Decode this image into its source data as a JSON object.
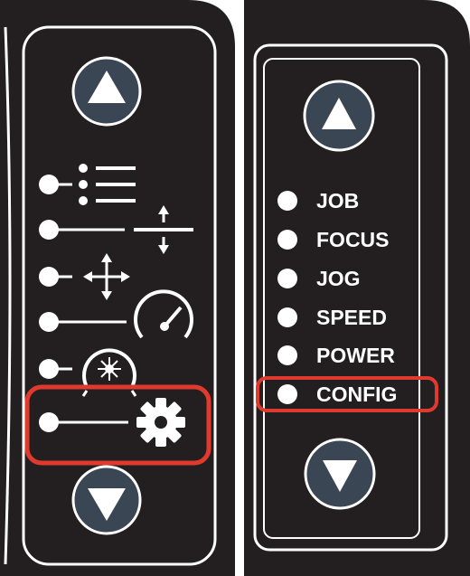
{
  "left_panel": {
    "icons": [
      {
        "name": "job-list-icon"
      },
      {
        "name": "focus-updown-icon"
      },
      {
        "name": "jog-move-icon"
      },
      {
        "name": "speed-gauge-icon"
      },
      {
        "name": "power-laser-icon"
      },
      {
        "name": "config-gear-icon"
      }
    ],
    "highlighted_index": 5
  },
  "right_panel": {
    "menu": [
      {
        "label": "JOB"
      },
      {
        "label": "FOCUS"
      },
      {
        "label": "JOG"
      },
      {
        "label": "SPEED"
      },
      {
        "label": "POWER"
      },
      {
        "label": "CONFIG"
      }
    ],
    "highlighted_index": 5
  },
  "colors": {
    "panel": "#231f20",
    "button": "#3a4654",
    "highlight": "#e03a2f",
    "foreground": "#ffffff"
  }
}
